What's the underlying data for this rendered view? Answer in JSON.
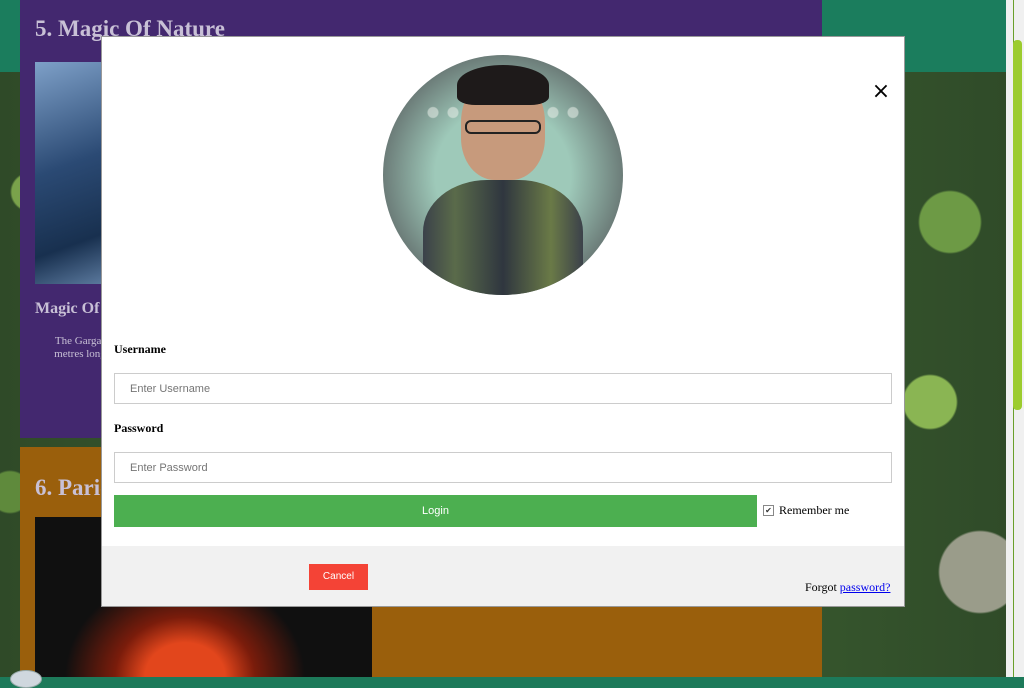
{
  "background_page": {
    "section5_title": "5. Magic Of Nature",
    "section5_subtitle": "Magic Of",
    "section5_desc": "The Gargar metres long",
    "section6_title": "6. Paric"
  },
  "login_modal": {
    "close_glyph": "×",
    "username_label": "Username",
    "username_placeholder": "Enter Username",
    "password_label": "Password",
    "password_placeholder": "Enter Password",
    "login_button": "Login",
    "remember_checked": true,
    "remember_label": "Remember me",
    "cancel_button": "Cancel",
    "forgot_text": "Forgot",
    "forgot_link": "password?"
  },
  "colors": {
    "login_green": "#4caf50",
    "cancel_red": "#f44336",
    "purple_card": "#43286f",
    "orange_card": "#9a5f0c"
  },
  "icons": {
    "close": "close-icon",
    "checkbox": "checkmark-icon"
  }
}
